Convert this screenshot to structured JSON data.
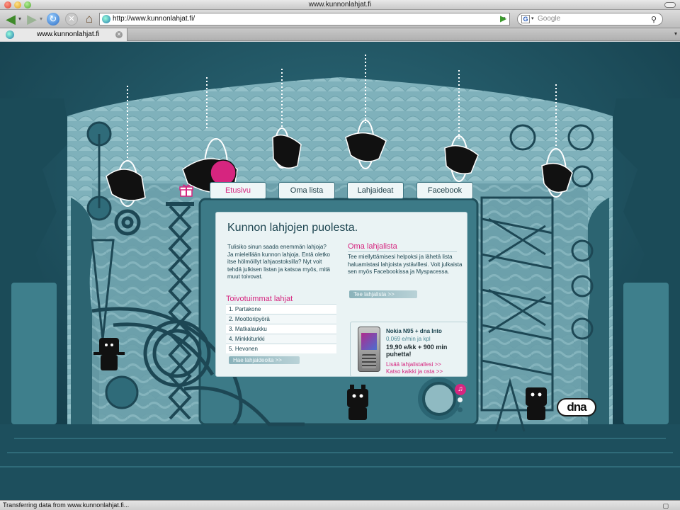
{
  "window": {
    "title": "www.kunnonlahjat.fi"
  },
  "toolbar": {
    "url": "http://www.kunnonlahjat.fi/",
    "search_placeholder": "Google"
  },
  "tabs": [
    {
      "label": "www.kunnonlahjat.fi"
    }
  ],
  "site": {
    "nav": [
      "Etusivu",
      "Oma lista",
      "Lahjaideat",
      "Facebook"
    ],
    "heading": "Kunnon lahjojen puolesta.",
    "intro": "Tulisiko sinun saada enemmän lahjoja? Ja mielellään kunnon lahjoja. Entä oletko itse hölmöillyt lahjaostoksilla? Nyt voit tehdä julkisen listan ja katsoa myös, mitä muut toivovat.",
    "favorites": {
      "heading": "Toivotuimmat lahjat",
      "items": [
        "1. Partakone",
        "2. Moottoripyörä",
        "3. Matkalaukku",
        "4. Minkkiturkki",
        "5. Hevonen"
      ],
      "button": "Hae lahjaideoita  >>"
    },
    "own_list": {
      "heading": "Oma lahjalista",
      "text": "Tee miellyttämisesi helpoksi ja lähetä lista haluamistasi lahjoista ystävillesi. Voit julkaista sen myös Facebookissa ja Myspacessa.",
      "button": "Tee lahjalista  >>"
    },
    "promo": {
      "title": "Nokia N95 + dna Into",
      "rate": "0,069 e/min ja kpl",
      "price": "19,90 e/kk + 900 min puhetta!",
      "link1": "Lisää lahjalistallesi  >>",
      "link2": "Katso kaikki ja osta  >>"
    },
    "logo": "dna"
  },
  "statusbar": {
    "text": "Transferring data from www.kunnonlahjat.fi..."
  },
  "colors": {
    "accent": "#d6257f",
    "background": "#1f5363",
    "panel": "#eaf3f4"
  }
}
